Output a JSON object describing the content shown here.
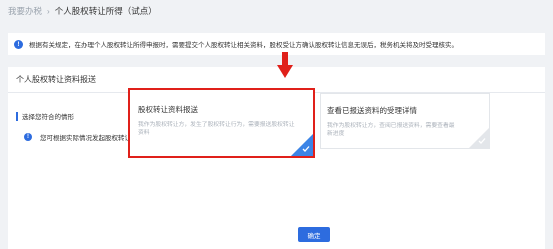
{
  "breadcrumb": {
    "home": "我要办税",
    "separator": "›",
    "current": "个人股权转让所得（试点）"
  },
  "notice": {
    "icon": "info-icon",
    "text": "根据有关规定，在办理个人股权转让所得申报时，需要提交个人股权转让相关资料，股权受让方确认股权转让信息无误后，税务机关将及时受理核实。"
  },
  "panel": {
    "title": "个人股权转让资料报送",
    "section_label": "选择您符合的情形",
    "hint": "您可根据实际情况发起股权转让资料报送或者查看已报送的资料详情"
  },
  "cards": [
    {
      "title": "股权转让资料报送",
      "desc": "我作为股权转让方，发生了股权转让行为，需要报送股权转让资料",
      "selected": true
    },
    {
      "title": "查看已报送资料的受理详情",
      "desc": "我作为股权转让方，查阅已报送资料，需要查看最新进度",
      "selected": false
    }
  ],
  "confirm_label": "确定",
  "colors": {
    "primary": "#2d6cdf",
    "highlight": "#e0201a",
    "background": "#f0f2f5"
  }
}
